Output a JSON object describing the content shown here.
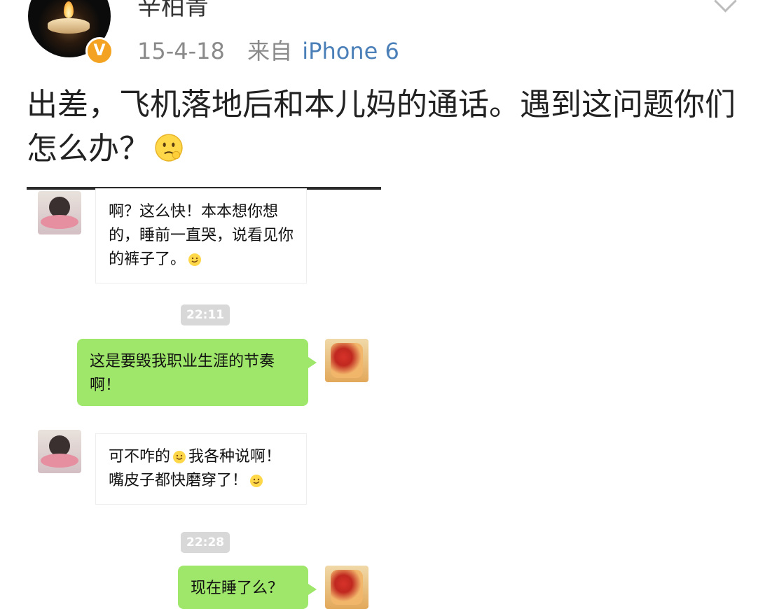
{
  "post": {
    "username": "辛柏青",
    "date": "15-4-18",
    "source_prefix": "来自",
    "source_device": "iPhone 6",
    "verified_badge": "V",
    "text": "出差，飞机落地后和本儿妈的通话。遇到这问题你们怎么办？",
    "emoji": "thinking-face-icon"
  },
  "chat": {
    "messages": [
      {
        "side": "in",
        "text": "啊？这么快！本本想你想的，睡前一直哭，说看见你的裤子了。"
      },
      {
        "timestamp": "22:11"
      },
      {
        "side": "out",
        "text": "这是要毁我职业生涯的节奏啊！"
      },
      {
        "side": "in",
        "text_a": "可不咋的",
        "text_b": "我各种说啊！嘴皮子都快磨穿了！"
      },
      {
        "timestamp": "22:28"
      },
      {
        "side": "out",
        "text": "现在睡了么？"
      }
    ]
  },
  "colors": {
    "verified": "#f3a321",
    "source_link": "#4a7fb8",
    "bubble_out": "#9fe76a",
    "timestamp_bg": "#d8d8d8"
  }
}
